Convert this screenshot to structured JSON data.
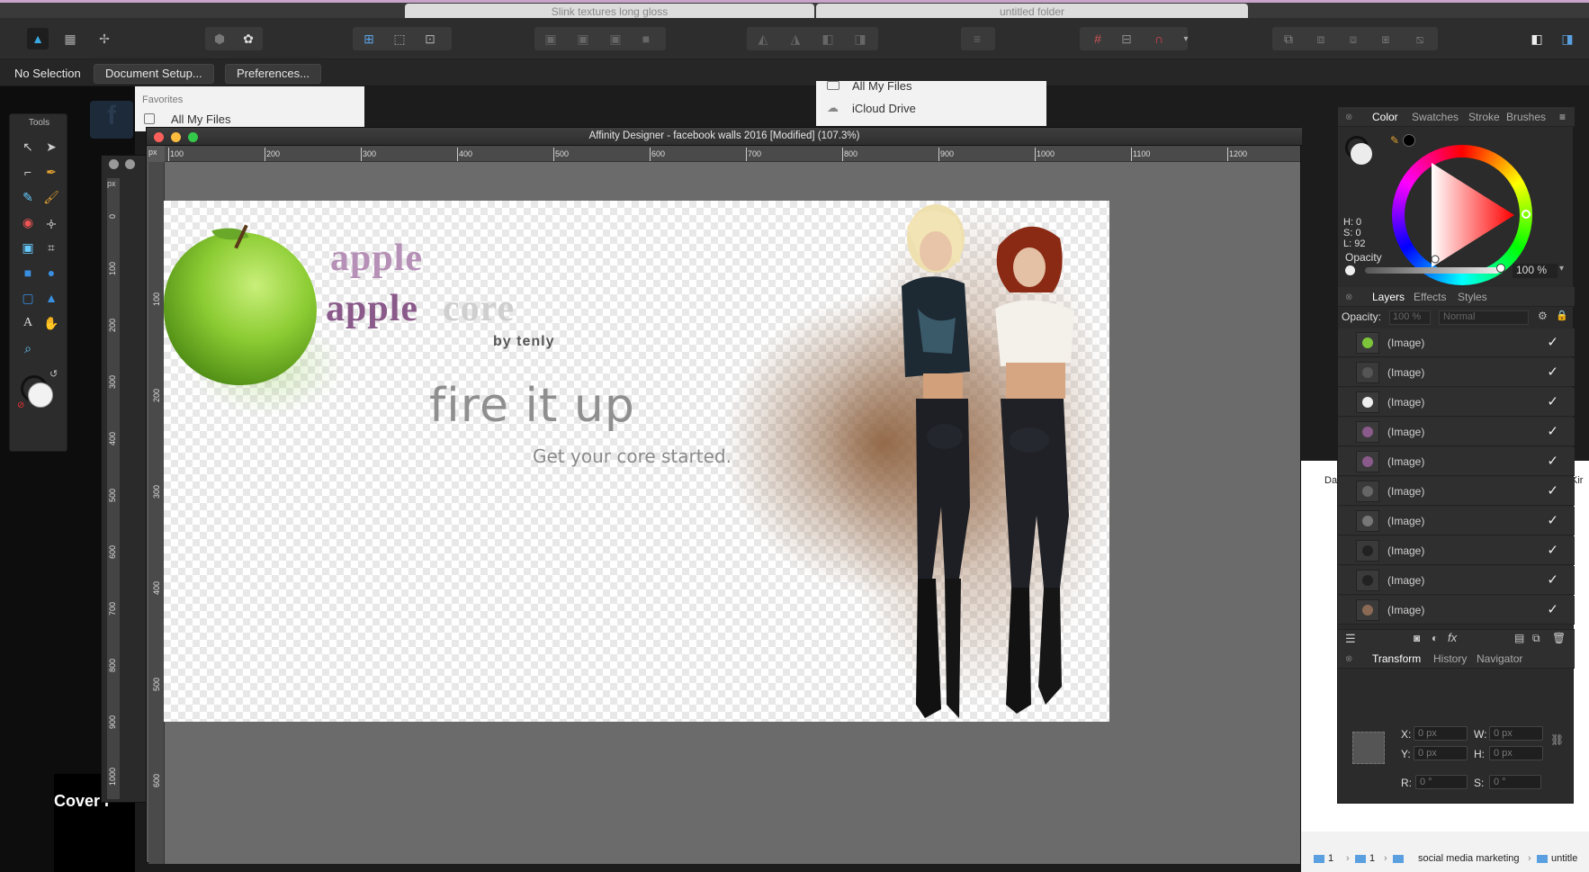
{
  "os": {
    "tab1_title": "Slink textures long gloss",
    "tab2_title": "untitled folder"
  },
  "toolbar": {
    "personas": [
      "designer-persona-icon",
      "pixel-persona-icon",
      "export-persona-icon"
    ]
  },
  "context_bar": {
    "selection": "No Selection",
    "doc_setup": "Document Setup...",
    "preferences": "Preferences..."
  },
  "finder_left": {
    "favorites": "Favorites",
    "all_files": "All My Files"
  },
  "finder_right": {
    "all_files": "All My Files",
    "icloud": "iCloud Drive"
  },
  "tools": {
    "title": "Tools"
  },
  "background": {
    "cover_text": "Cover P"
  },
  "document": {
    "title": "Affinity Designer - facebook walls 2016 [Modified] (107.3%)",
    "ruler_unit": "px",
    "h_ticks": [
      "100",
      "200",
      "300",
      "400",
      "500",
      "600",
      "700",
      "800",
      "900",
      "1000",
      "1100",
      "1200"
    ],
    "v_ticks": [
      "100",
      "200",
      "300",
      "400",
      "500",
      "600"
    ],
    "v_ticks_back": [
      "0",
      "100",
      "200",
      "300",
      "400",
      "500",
      "600",
      "700",
      "800",
      "900",
      "1000"
    ]
  },
  "artboard": {
    "apple_text_1": "apple",
    "apple_text_2": "apple",
    "core_text": "core",
    "by_text": "by tenly",
    "headline": "fire it up",
    "tagline": "Get your core started."
  },
  "color_panel": {
    "tabs": [
      "Color",
      "Swatches",
      "Stroke",
      "Brushes"
    ],
    "h": "H: 0",
    "s": "S: 0",
    "l": "L: 92",
    "opacity_label": "Opacity",
    "opacity_value": "100 %"
  },
  "layers_panel": {
    "tabs": [
      "Layers",
      "Effects",
      "Styles"
    ],
    "opacity_label": "Opacity:",
    "opacity_value": "100 %",
    "blend_mode": "Normal",
    "layers": [
      {
        "name": "(Image)",
        "thumb": "green-apple"
      },
      {
        "name": "(Image)",
        "thumb": "by tenly"
      },
      {
        "name": "(Image)",
        "thumb": "core"
      },
      {
        "name": "(Image)",
        "thumb": "apple"
      },
      {
        "name": "(Image)",
        "thumb": "apple"
      },
      {
        "name": "(Image)",
        "thumb": "tagline"
      },
      {
        "name": "(Image)",
        "thumb": "fire it up"
      },
      {
        "name": "(Image)",
        "thumb": "figure"
      },
      {
        "name": "(Image)",
        "thumb": "figure"
      },
      {
        "name": "(Image)",
        "thumb": "glow"
      }
    ],
    "check": "✓"
  },
  "transform_panel": {
    "tabs": [
      "Transform",
      "History",
      "Navigator"
    ],
    "x_label": "X:",
    "x_value": "0 px",
    "y_label": "Y:",
    "y_value": "0 px",
    "w_label": "W:",
    "w_value": "0 px",
    "h_label": "H:",
    "h_value": "0 px",
    "r_label": "R:",
    "r_value": "0 °",
    "s_label": "S:",
    "s_value": "0 °"
  },
  "finder_bottom": {
    "path": [
      "1",
      "1",
      "social media marketing",
      "untitle"
    ],
    "col_da": "Da",
    "col_kir": "Kir"
  }
}
